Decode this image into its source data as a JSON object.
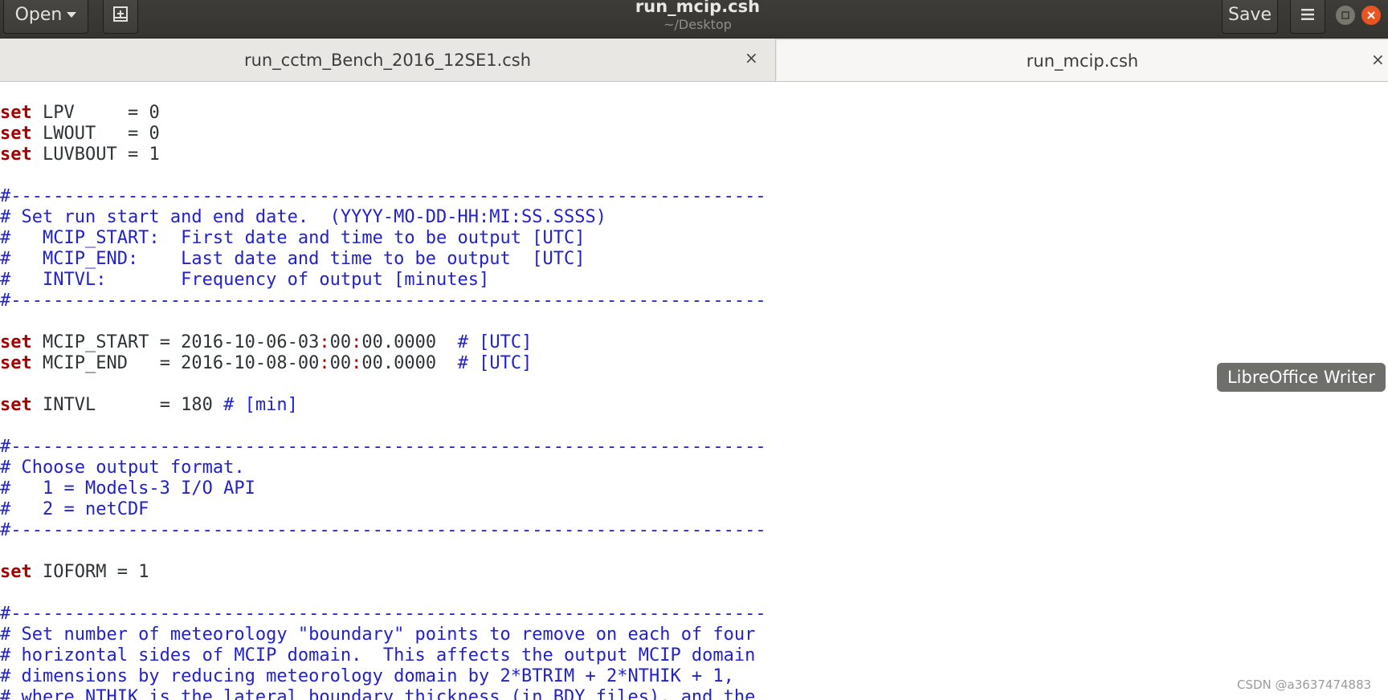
{
  "header": {
    "open_label": "Open",
    "title": "run_mcip.csh",
    "subtitle": "~/Desktop",
    "save_label": "Save"
  },
  "tabs": [
    {
      "label": "run_cctm_Bench_2016_12SE1.csh",
      "close": "×"
    },
    {
      "label": "run_mcip.csh",
      "close": "×"
    }
  ],
  "code": {
    "lines": [
      {
        "kw": "set",
        "rest": " LPV     = 0"
      },
      {
        "kw": "set",
        "rest": " LWOUT   = 0"
      },
      {
        "kw": "set",
        "rest": " LUVBOUT = 1"
      },
      {
        "text": "#-----------------------------------------------------------------------"
      },
      {
        "text": "# Set run start and end date.  (YYYY-MO-DD-HH:MI:SS.SSSS)"
      },
      {
        "text": "#   MCIP_START:  First date and time to be output [UTC]"
      },
      {
        "text": "#   MCIP_END:    Last date and time to be output  [UTC]"
      },
      {
        "text": "#   INTVL:       Frequency of output [minutes]"
      },
      {
        "text": "#-----------------------------------------------------------------------"
      },
      {
        "kw": "set",
        "p1": " MCIP_START = 2016-10-06-03",
        "p2": "00",
        "p3": "00.0000  ",
        "cmt": "# [UTC]"
      },
      {
        "kw": "set",
        "p1": " MCIP_END   = 2016-10-08-00",
        "p2": "00",
        "p3": "00.0000  ",
        "cmt": "# [UTC]"
      },
      {
        "kw": "set",
        "rest": " INTVL      = 180 ",
        "cmt": "# [min]"
      },
      {
        "text": "#-----------------------------------------------------------------------"
      },
      {
        "text": "# Choose output format."
      },
      {
        "text": "#   1 = Models-3 I/O API"
      },
      {
        "text": "#   2 = netCDF"
      },
      {
        "text": "#-----------------------------------------------------------------------"
      },
      {
        "kw": "set",
        "rest": " IOFORM = 1"
      },
      {
        "text": "#-----------------------------------------------------------------------"
      },
      {
        "text": "# Set number of meteorology \"boundary\" points to remove on each of four"
      },
      {
        "text": "# horizontal sides of MCIP domain.  This affects the output MCIP domain"
      },
      {
        "text": "# dimensions by reducing meteorology domain by 2*BTRIM + 2*NTHIK + 1,"
      },
      {
        "text": "# where NTHIK is the lateral boundary thickness (in BDY files), and the"
      }
    ]
  },
  "tooltip": "LibreOffice Writer",
  "watermark": "CSDN @a3637474883"
}
